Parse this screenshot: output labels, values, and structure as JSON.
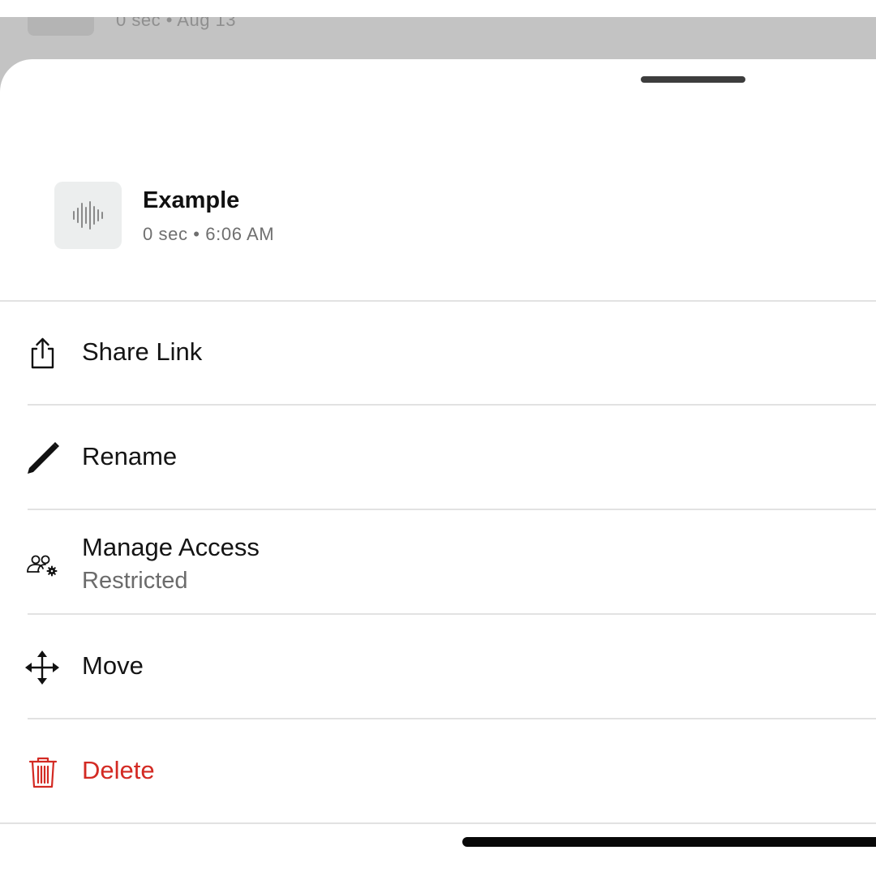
{
  "background_item": {
    "meta": "0 sec • Aug 13"
  },
  "file": {
    "name": "Example",
    "meta": "0 sec • 6:06 AM",
    "icon": "waveform-icon"
  },
  "menu": [
    {
      "id": "share",
      "label": "Share Link",
      "icon": "share-icon"
    },
    {
      "id": "rename",
      "label": "Rename",
      "icon": "pencil-icon"
    },
    {
      "id": "manage-access",
      "label": "Manage Access",
      "sublabel": "Restricted",
      "icon": "people-settings-icon"
    },
    {
      "id": "move",
      "label": "Move",
      "icon": "move-arrows-icon"
    },
    {
      "id": "delete",
      "label": "Delete",
      "icon": "trash-icon",
      "color": "#d32a23"
    }
  ],
  "colors": {
    "danger": "#d32a23",
    "backdrop": "#c3c3c3",
    "sheet": "#ffffff"
  }
}
